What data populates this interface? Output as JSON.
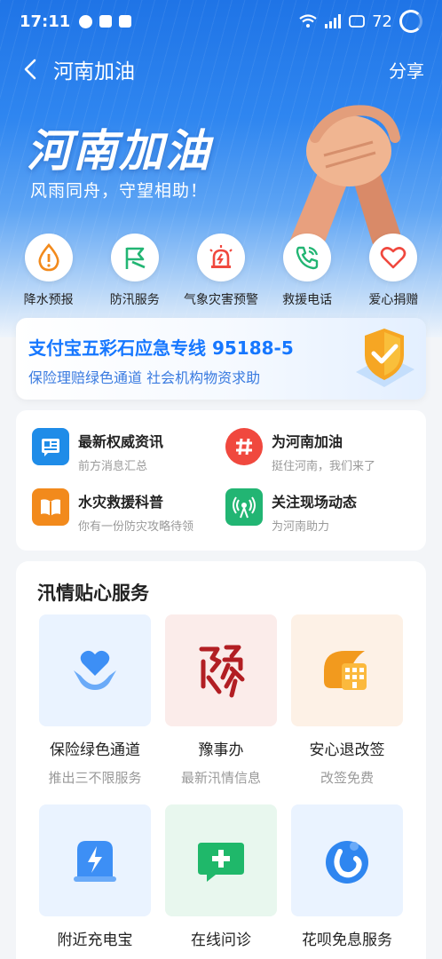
{
  "status_bar": {
    "time": "17:11",
    "battery": "72"
  },
  "nav": {
    "title": "河南加油",
    "share_label": "分享"
  },
  "banner": {
    "title": "河南加油",
    "subtitle": "风雨同舟，守望相助！"
  },
  "quick_actions": [
    {
      "label": "降水预报",
      "icon": "raindrop-warning-icon",
      "color": "#f28a1c"
    },
    {
      "label": "防汛服务",
      "icon": "flag-icon",
      "color": "#22b573"
    },
    {
      "label": "气象灾害预警",
      "icon": "alarm-light-icon",
      "color": "#f0483e"
    },
    {
      "label": "救援电话",
      "icon": "phone-icon",
      "color": "#22b573"
    },
    {
      "label": "爱心捐赠",
      "icon": "heart-icon",
      "color": "#f0483e"
    }
  ],
  "hotline": {
    "title": "支付宝五彩石应急专线 95188-5",
    "subtitle": "保险理赔绿色通道 社会机构物资求助"
  },
  "news": [
    {
      "title": "最新权威资讯",
      "subtitle": "前方消息汇总",
      "icon": "news-icon",
      "color": "#1f8ce8"
    },
    {
      "title": "为河南加油",
      "subtitle": "挺住河南，我们来了",
      "icon": "hashtag-icon",
      "color": "#f0483e"
    },
    {
      "title": "水灾救援科普",
      "subtitle": "你有一份防灾攻略待领",
      "icon": "book-icon",
      "color": "#f28a1c"
    },
    {
      "title": "关注现场动态",
      "subtitle": "为河南助力",
      "icon": "broadcast-icon",
      "color": "#22b573"
    }
  ],
  "services": {
    "title": "汛情贴心服务",
    "items": [
      {
        "name": "保险绿色通道",
        "desc": "推出三不限服务",
        "icon": "heart-hands-icon",
        "bg": "#eaf3ff"
      },
      {
        "name": "豫事办",
        "desc": "最新汛情信息",
        "icon": "yu-seal-icon",
        "bg": "#fbecea"
      },
      {
        "name": "安心退改签",
        "desc": "改签免费",
        "icon": "building-icon",
        "bg": "#fdf1e6"
      },
      {
        "name": "附近充电宝",
        "desc": "",
        "icon": "power-bank-icon",
        "bg": "#eaf3ff"
      },
      {
        "name": "在线问诊",
        "desc": "",
        "icon": "medical-chat-icon",
        "bg": "#e8f7ee"
      },
      {
        "name": "花呗免息服务",
        "desc": "",
        "icon": "huabei-icon",
        "bg": "#eaf3ff"
      }
    ]
  }
}
